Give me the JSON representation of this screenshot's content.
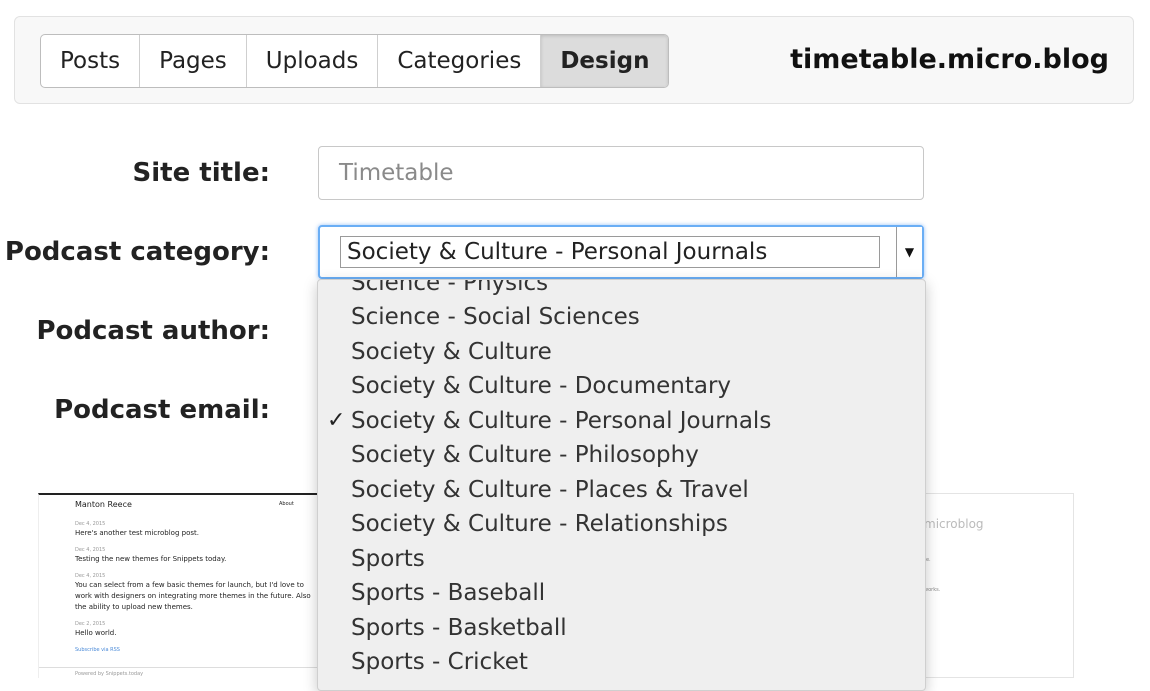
{
  "nav": {
    "tabs": [
      {
        "label": "Posts"
      },
      {
        "label": "Pages"
      },
      {
        "label": "Uploads"
      },
      {
        "label": "Categories"
      },
      {
        "label": "Design"
      }
    ],
    "active_tab": "Design",
    "site_name": "timetable.micro.blog"
  },
  "form": {
    "site_title_label": "Site title:",
    "site_title_placeholder": "Timetable",
    "podcast_category_label": "Podcast category:",
    "podcast_category_value": "Society & Culture - Personal Journals",
    "podcast_author_label": "Podcast author:",
    "podcast_email_label": "Podcast email:"
  },
  "dropdown": {
    "check_mark": "✓",
    "options": [
      {
        "label": "Science - Physics"
      },
      {
        "label": "Science - Social Sciences"
      },
      {
        "label": "Society & Culture"
      },
      {
        "label": "Society & Culture - Documentary"
      },
      {
        "label": "Society & Culture - Personal Journals"
      },
      {
        "label": "Society & Culture - Philosophy"
      },
      {
        "label": "Society & Culture - Places & Travel"
      },
      {
        "label": "Society & Culture - Relationships"
      },
      {
        "label": "Sports"
      },
      {
        "label": "Sports - Baseball"
      },
      {
        "label": "Sports - Basketball"
      },
      {
        "label": "Sports - Cricket"
      }
    ]
  },
  "preview_left": {
    "author": "Manton Reece",
    "nav_link": "About",
    "posts": [
      {
        "date": "Dec 4, 2015",
        "text": "Here's another test microblog post."
      },
      {
        "date": "Dec 4, 2015",
        "text": "Testing the new themes for Snippets today."
      },
      {
        "date": "Dec 4, 2015",
        "lines": [
          "You can select from a few basic themes for launch, but I'd love to",
          "work with designers on integrating more themes in the future. Also",
          "the ability to upload new themes."
        ]
      },
      {
        "date": "Dec 2, 2015",
        "text": "Hello world."
      }
    ],
    "subscribe": "Subscribe via RSS",
    "footer": "Powered by Snippets.today"
  },
  "preview_right": {
    "title": "microblog",
    "line1": "te.",
    "line2": "works."
  }
}
